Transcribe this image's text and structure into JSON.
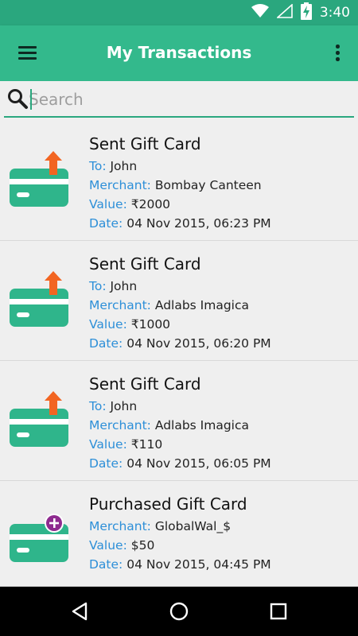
{
  "status_bar": {
    "time": "3:40",
    "icons": [
      "wifi-icon",
      "signal-icon",
      "battery-charging-icon"
    ]
  },
  "app_bar": {
    "title": "My Transactions",
    "menu_icon": "hamburger-menu-icon",
    "more_icon": "more-vert-icon"
  },
  "search": {
    "placeholder": "Search",
    "value": ""
  },
  "transactions": [
    {
      "title": "Sent Gift Card",
      "icon": "sent-gift-card-icon",
      "fields": [
        {
          "label": "To:",
          "value": "John"
        },
        {
          "label": "Merchant:",
          "value": "Bombay Canteen"
        },
        {
          "label": "Value:",
          "value": "₹2000"
        },
        {
          "label": "Date:",
          "value": "04 Nov 2015, 06:23 PM"
        }
      ]
    },
    {
      "title": "Sent Gift Card",
      "icon": "sent-gift-card-icon",
      "fields": [
        {
          "label": "To:",
          "value": "John"
        },
        {
          "label": "Merchant:",
          "value": "Adlabs Imagica"
        },
        {
          "label": "Value:",
          "value": "₹1000"
        },
        {
          "label": "Date:",
          "value": "04 Nov 2015, 06:20 PM"
        }
      ]
    },
    {
      "title": "Sent Gift Card",
      "icon": "sent-gift-card-icon",
      "fields": [
        {
          "label": "To:",
          "value": "John"
        },
        {
          "label": "Merchant:",
          "value": "Adlabs Imagica"
        },
        {
          "label": "Value:",
          "value": "₹110"
        },
        {
          "label": "Date:",
          "value": "04 Nov 2015, 06:05 PM"
        }
      ]
    },
    {
      "title": "Purchased Gift Card",
      "icon": "purchased-gift-card-icon",
      "fields": [
        {
          "label": "Merchant:",
          "value": "GlobalWal_$"
        },
        {
          "label": "Value:",
          "value": "$50"
        },
        {
          "label": "Date:",
          "value": "04 Nov 2015, 04:45 PM"
        }
      ]
    }
  ],
  "nav_bar": {
    "icons": [
      "back-icon",
      "home-icon",
      "recents-icon"
    ]
  },
  "colors": {
    "primary": "#33b98c",
    "primary_dark": "#2aa77e",
    "label_blue": "#2d8fd8",
    "card_green": "#2fb58b",
    "arrow_orange": "#f26522",
    "plus_purple": "#8e2a8f"
  }
}
